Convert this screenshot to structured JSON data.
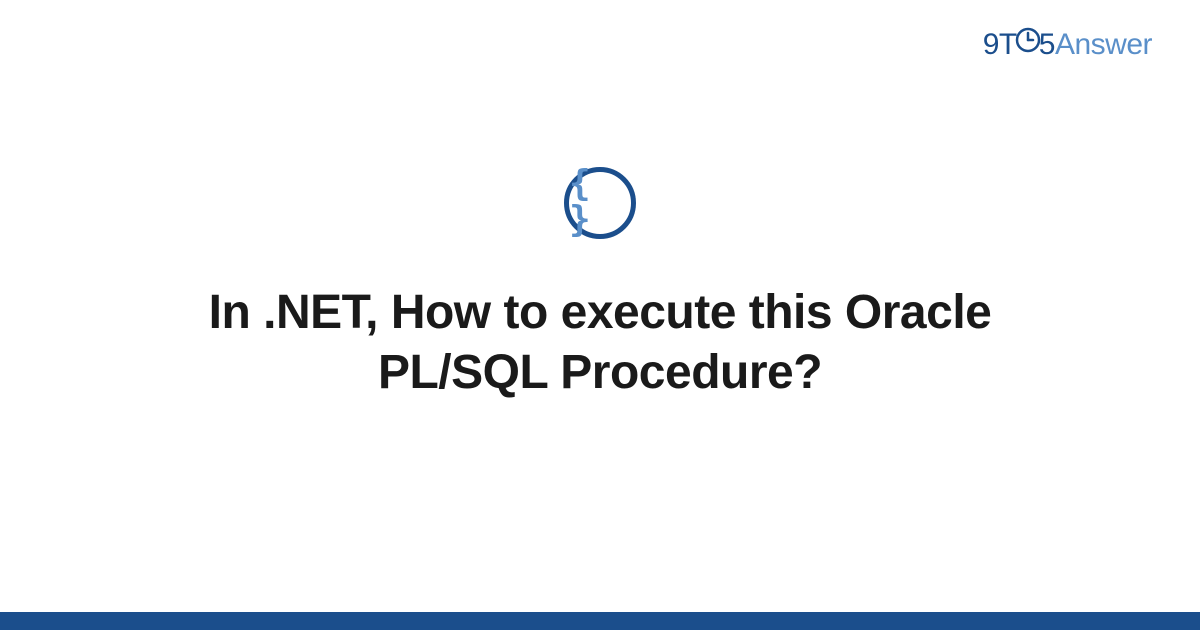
{
  "brand": {
    "prefix": "9T",
    "middle": "5",
    "suffix": "Answer"
  },
  "icon": {
    "glyph": "{ }"
  },
  "title": "In .NET, How to execute this Oracle PL/SQL Procedure?",
  "colors": {
    "primary": "#1b4e8c",
    "accent": "#5a8fc9"
  }
}
